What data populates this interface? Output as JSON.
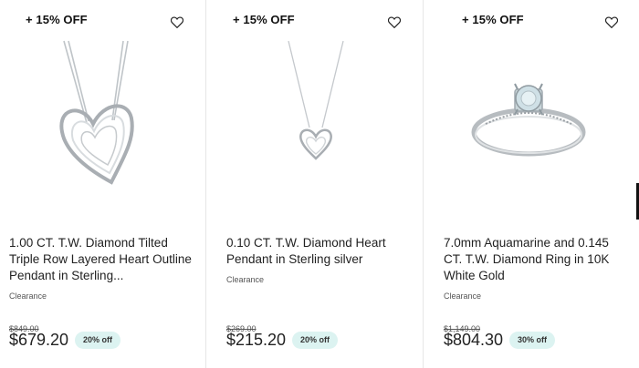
{
  "products": [
    {
      "promo": "+ 15% OFF",
      "title": "1.00 CT. T.W. Diamond Tilted Triple Row Layered Heart Outline Pendant in Sterling...",
      "tag": "Clearance",
      "was_price": "$849.00",
      "price": "$679.20",
      "discount": "20% off",
      "image_icon": "heart-pendant-necklace"
    },
    {
      "promo": "+ 15% OFF",
      "title": "0.10 CT. T.W. Diamond Heart Pendant in Sterling silver",
      "tag": "Clearance",
      "was_price": "$269.00",
      "price": "$215.20",
      "discount": "20% off",
      "image_icon": "small-heart-pendant-necklace"
    },
    {
      "promo": "+ 15% OFF",
      "title": "7.0mm Aquamarine and 0.145 CT. T.W. Diamond Ring in 10K White Gold",
      "tag": "Clearance",
      "was_price": "$1,149.00",
      "price": "$804.30",
      "discount": "30% off",
      "image_icon": "aquamarine-ring"
    }
  ],
  "colors": {
    "badge_bg": "#dcf3f1",
    "divider": "#e6e6e6",
    "text": "#222222"
  }
}
